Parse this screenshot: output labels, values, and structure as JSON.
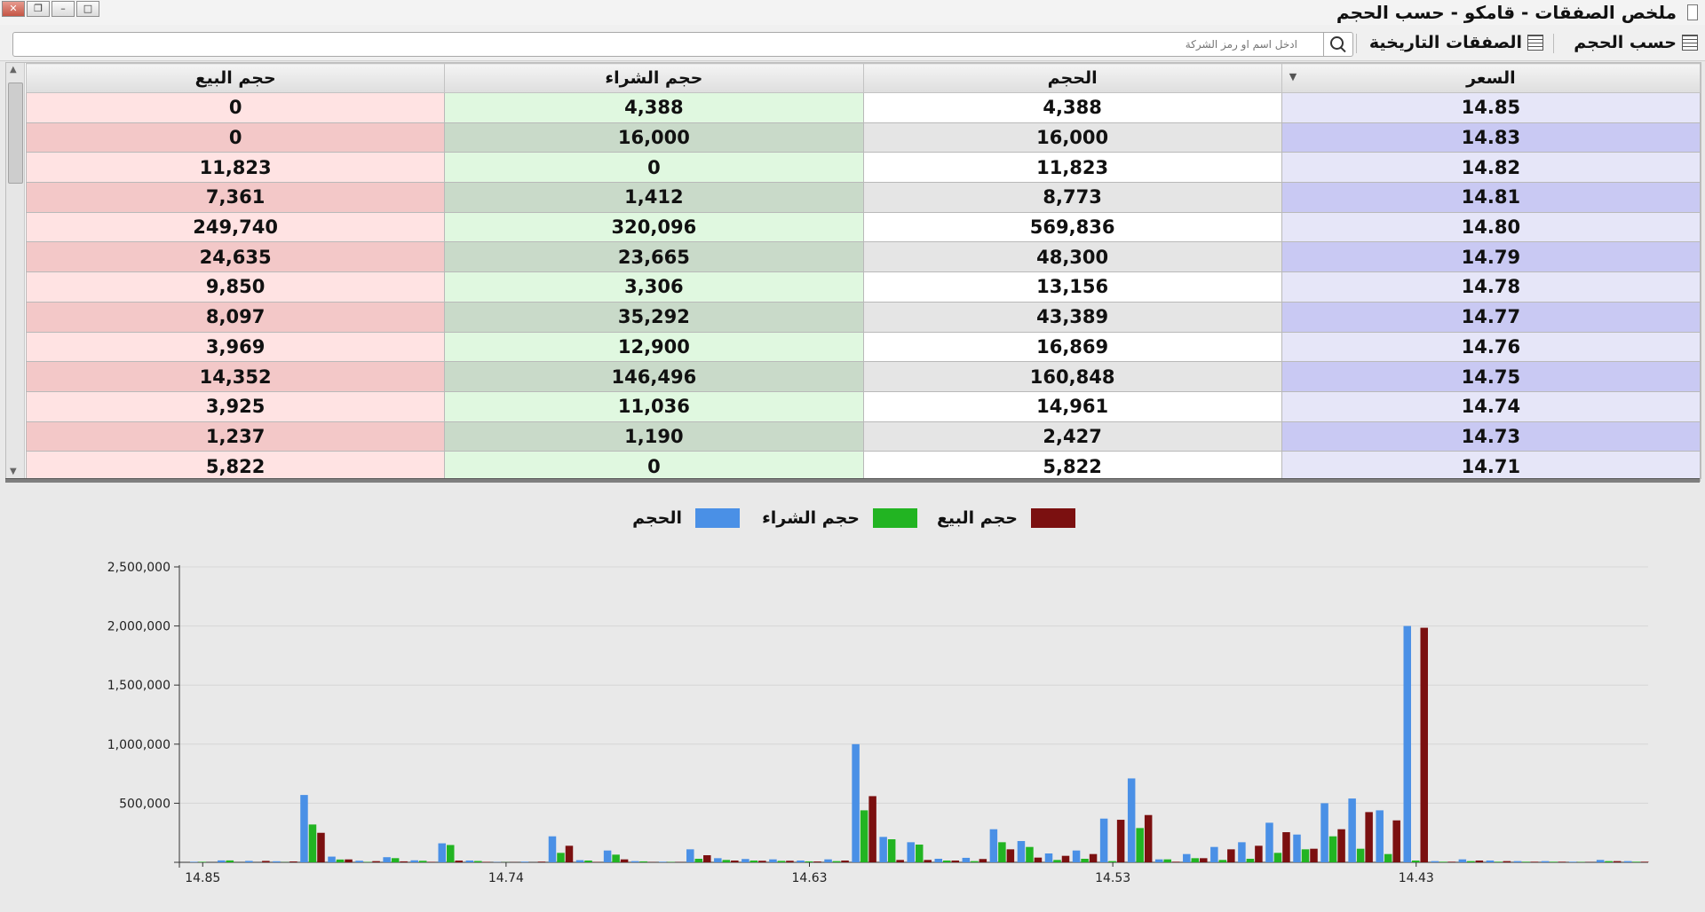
{
  "window": {
    "title": "ملخص الصفقات - قامكو - حسب الحجم",
    "buttons": [
      "close",
      "restore",
      "minimize",
      "maximize"
    ]
  },
  "toolbar": {
    "by_volume": "حسب الحجم",
    "historical_trades": "الصفقات التاريخية",
    "search_placeholder": "ادخل اسم او رمز الشركة"
  },
  "table": {
    "columns": [
      "حجم البيع",
      "حجم الشراء",
      "الحجم",
      "السعر"
    ],
    "rows": [
      {
        "sell": "0",
        "buy": "4,388",
        "volume": "4,388",
        "price": "14.85"
      },
      {
        "sell": "0",
        "buy": "16,000",
        "volume": "16,000",
        "price": "14.83"
      },
      {
        "sell": "11,823",
        "buy": "0",
        "volume": "11,823",
        "price": "14.82"
      },
      {
        "sell": "7,361",
        "buy": "1,412",
        "volume": "8,773",
        "price": "14.81"
      },
      {
        "sell": "249,740",
        "buy": "320,096",
        "volume": "569,836",
        "price": "14.80"
      },
      {
        "sell": "24,635",
        "buy": "23,665",
        "volume": "48,300",
        "price": "14.79"
      },
      {
        "sell": "9,850",
        "buy": "3,306",
        "volume": "13,156",
        "price": "14.78"
      },
      {
        "sell": "8,097",
        "buy": "35,292",
        "volume": "43,389",
        "price": "14.77"
      },
      {
        "sell": "3,969",
        "buy": "12,900",
        "volume": "16,869",
        "price": "14.76"
      },
      {
        "sell": "14,352",
        "buy": "146,496",
        "volume": "160,848",
        "price": "14.75"
      },
      {
        "sell": "3,925",
        "buy": "11,036",
        "volume": "14,961",
        "price": "14.74"
      },
      {
        "sell": "1,237",
        "buy": "1,190",
        "volume": "2,427",
        "price": "14.73"
      },
      {
        "sell": "5,822",
        "buy": "0",
        "volume": "5,822",
        "price": "14.71"
      }
    ]
  },
  "chart_data": {
    "type": "bar",
    "title": "",
    "xlabel": "",
    "ylabel": "",
    "ylim": [
      0,
      2500000
    ],
    "yticks": [
      "2,500,000",
      "2,000,000",
      "1,500,000",
      "1,000,000",
      "500,000"
    ],
    "xtick_labels": [
      "14.85",
      "14.74",
      "14.63",
      "14.53",
      "14.43"
    ],
    "xtick_index": [
      0,
      11,
      22,
      33,
      44
    ],
    "legend_position": "top-center",
    "categories": [
      "14.85",
      "14.84",
      "14.83",
      "14.82",
      "14.81",
      "14.80",
      "14.79",
      "14.78",
      "14.77",
      "14.76",
      "14.75",
      "14.74",
      "14.73",
      "14.72",
      "14.71",
      "14.70",
      "14.69",
      "14.68",
      "14.67",
      "14.66",
      "14.65",
      "14.64",
      "14.63",
      "14.62",
      "14.61",
      "14.60",
      "14.59",
      "14.58",
      "14.57",
      "14.56",
      "14.55",
      "14.54",
      "14.53",
      "14.52",
      "14.51",
      "14.50",
      "14.49",
      "14.48",
      "14.47",
      "14.46",
      "14.45",
      "14.44",
      "14.43",
      "14.42",
      "14.41",
      "14.40",
      "14.39",
      "14.38",
      "14.37",
      "14.36",
      "14.35",
      "14.34",
      "14.33"
    ],
    "series": [
      {
        "name": "الحجم",
        "color": "#4a90e6",
        "values": [
          4388,
          16000,
          11823,
          8773,
          569836,
          48300,
          13156,
          43389,
          16869,
          160848,
          14961,
          2427,
          5822,
          220000,
          18000,
          100000,
          10000,
          5000,
          110000,
          35000,
          28000,
          25000,
          15000,
          25000,
          1000000,
          215000,
          170000,
          30000,
          38000,
          280000,
          180000,
          75000,
          100000,
          370000,
          710000,
          25000,
          70000,
          130000,
          170000,
          335000,
          235000,
          500000,
          540000,
          440000,
          2000000,
          10000,
          25000,
          15000,
          10000,
          10000,
          5000,
          20000,
          10000
        ]
      },
      {
        "name": "حجم الشراء",
        "color": "#22b422",
        "values": [
          4388,
          16000,
          0,
          1412,
          320096,
          23665,
          3306,
          35292,
          12900,
          146496,
          11036,
          1190,
          0,
          80000,
          15000,
          65000,
          8000,
          3000,
          30000,
          20000,
          15000,
          12000,
          8000,
          10000,
          440000,
          195000,
          150000,
          15000,
          10000,
          170000,
          130000,
          20000,
          30000,
          10000,
          290000,
          25000,
          35000,
          20000,
          30000,
          80000,
          110000,
          220000,
          115000,
          70000,
          15000,
          5000,
          10000,
          5000,
          5000,
          5000,
          3000,
          10000,
          5000
        ]
      },
      {
        "name": "حجم البيع",
        "color": "#7b1010",
        "values": [
          0,
          0,
          11823,
          7361,
          249740,
          24635,
          9850,
          8097,
          3969,
          14352,
          3925,
          1237,
          5822,
          140000,
          3000,
          25000,
          2000,
          2000,
          60000,
          15000,
          13000,
          13000,
          7000,
          15000,
          560000,
          20000,
          20000,
          15000,
          28000,
          110000,
          40000,
          55000,
          70000,
          360000,
          400000,
          5000,
          35000,
          110000,
          140000,
          255000,
          115000,
          280000,
          425000,
          355000,
          1985000,
          5000,
          15000,
          10000,
          5000,
          5000,
          2000,
          10000,
          5000
        ]
      }
    ]
  }
}
